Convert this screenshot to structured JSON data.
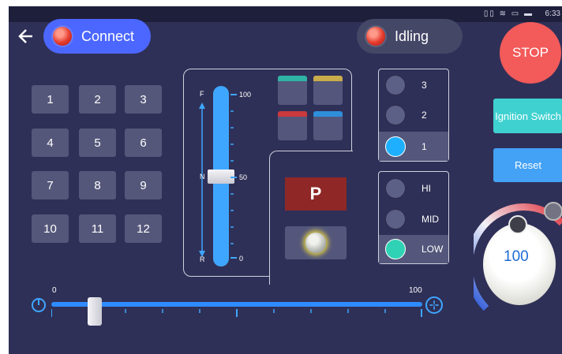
{
  "status_bar": {
    "icons": "▯▯ ≋ ▭ ▬",
    "time": "6:33"
  },
  "top_bar": {
    "connect_label": "Connect",
    "idling_label": "Idling",
    "stop_label": "STOP"
  },
  "side_buttons": {
    "ignition_label": "Ignition Switch",
    "reset_label": "Reset"
  },
  "numpad": {
    "keys": [
      "1",
      "2",
      "3",
      "4",
      "5",
      "6",
      "7",
      "8",
      "9",
      "10",
      "11",
      "12"
    ]
  },
  "gear_slider": {
    "forward_label": "F",
    "neutral_label": "N",
    "reverse_label": "R",
    "max_tick": "100",
    "mid_tick": "50",
    "min_tick": "0",
    "value_percent": 50
  },
  "color_buttons": [
    {
      "name": "teal",
      "color": "#2fb3a5"
    },
    {
      "name": "gold",
      "color": "#c9ac4c"
    },
    {
      "name": "red",
      "color": "#c9393d"
    },
    {
      "name": "blue",
      "color": "#2f8ed9"
    }
  ],
  "park_label": "P",
  "range_select": {
    "options": [
      "3",
      "2",
      "1"
    ],
    "selected": "1"
  },
  "speed_select": {
    "options": [
      "HI",
      "MID",
      "LOW"
    ],
    "selected": "LOW"
  },
  "throttle": {
    "min_label": "0",
    "max_label": "100",
    "value": 12
  },
  "dial": {
    "value": "100"
  },
  "colors": {
    "background": "#2f3057",
    "accent_blue": "#4c67ff",
    "stop_red": "#f35a5a"
  }
}
